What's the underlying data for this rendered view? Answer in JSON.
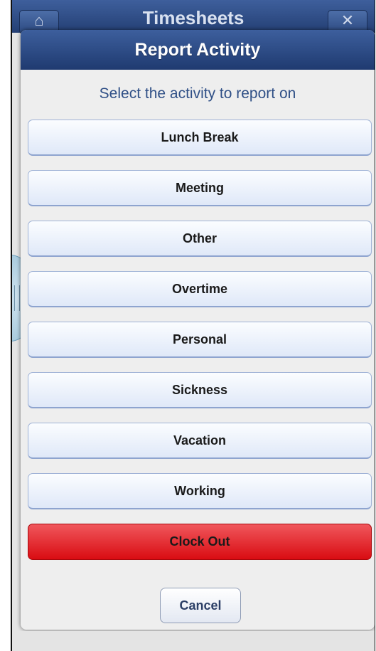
{
  "app_header": {
    "title": "Timesheets",
    "home_icon": "home-icon",
    "close_icon": "close-icon"
  },
  "dialog": {
    "title": "Report Activity",
    "subtitle": "Select the activity to report on",
    "activities": [
      {
        "label": "Lunch Break"
      },
      {
        "label": "Meeting"
      },
      {
        "label": "Other"
      },
      {
        "label": "Overtime"
      },
      {
        "label": "Personal"
      },
      {
        "label": "Sickness"
      },
      {
        "label": "Vacation"
      },
      {
        "label": "Working"
      }
    ],
    "clock_out_label": "Clock Out",
    "cancel_label": "Cancel"
  },
  "colors": {
    "header_blue": "#2c4a82",
    "clock_out_red": "#d90c12",
    "subtitle_text": "#2f4f86"
  }
}
